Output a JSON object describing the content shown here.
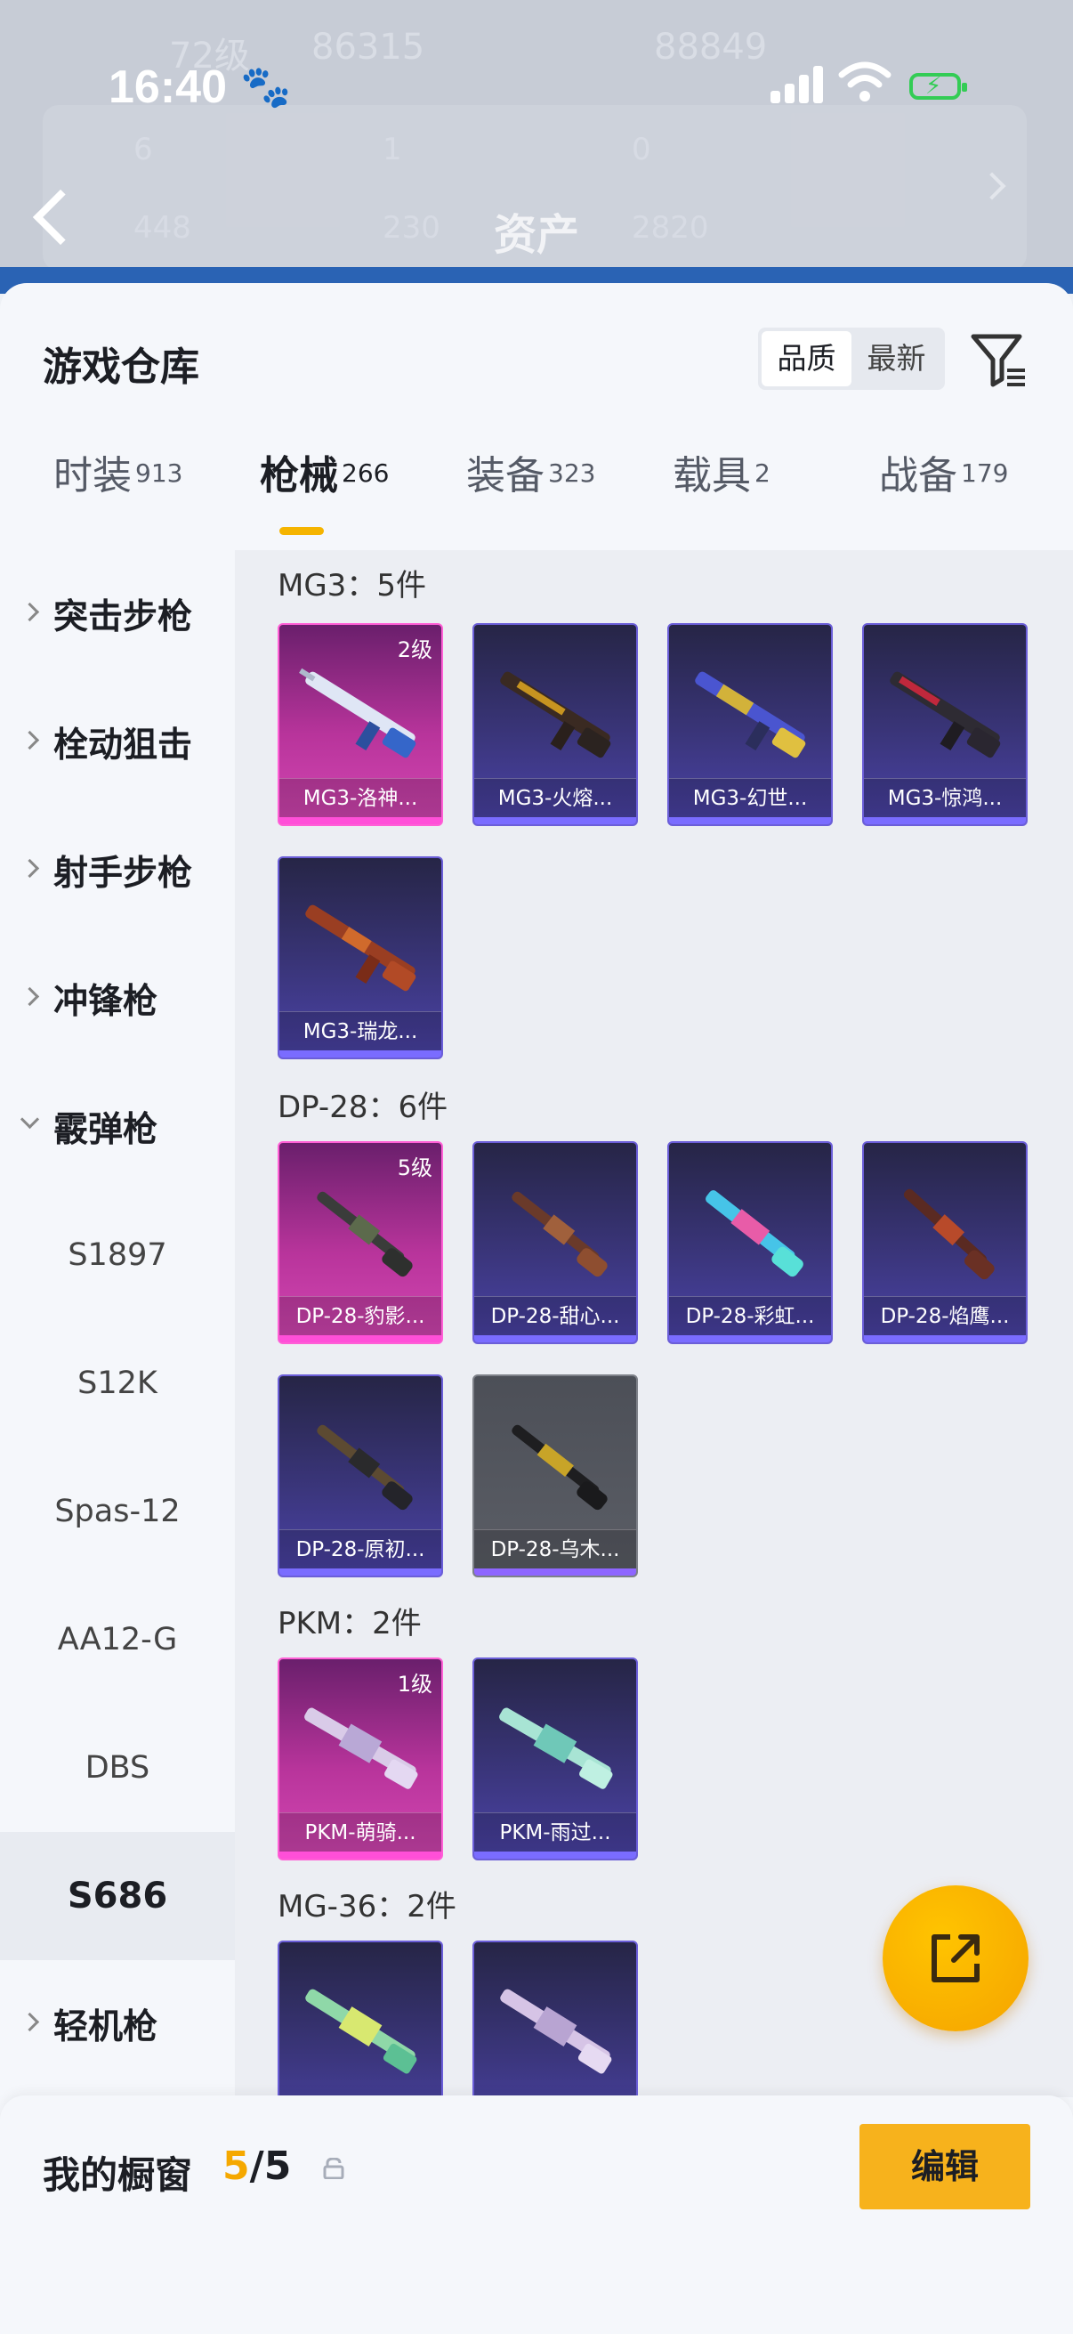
{
  "status_bar": {
    "time": "16:40"
  },
  "background": {
    "title": "资产",
    "ghost_texts": [
      "72级",
      "86315",
      "88849",
      "6",
      "1",
      "0",
      "448",
      "230",
      "2820"
    ]
  },
  "sheet": {
    "title": "游戏仓库",
    "sort_options": [
      "品质",
      "最新"
    ],
    "sort_selected": "品质"
  },
  "tabs": [
    {
      "label": "时装",
      "count": "913"
    },
    {
      "label": "枪械",
      "count": "266",
      "active": true
    },
    {
      "label": "装备",
      "count": "323"
    },
    {
      "label": "载具",
      "count": "2"
    },
    {
      "label": "战备",
      "count": "179"
    }
  ],
  "sidebar": {
    "categories": [
      "突击步枪",
      "栓动狙击",
      "射手步枪",
      "冲锋枪",
      "霰弹枪"
    ],
    "subitems": [
      "S1897",
      "S12K",
      "Spas-12",
      "AA12-G",
      "DBS",
      "S686"
    ],
    "selected_sub": "S686",
    "last_category": "轻机枪"
  },
  "groups": [
    {
      "title": "MG3：5件",
      "items": [
        {
          "name": "MG3-洛神...",
          "level": "2级",
          "rarity": "pink"
        },
        {
          "name": "MG3-火熔...",
          "rarity": "purple"
        },
        {
          "name": "MG3-幻世...",
          "rarity": "purple"
        },
        {
          "name": "MG3-惊鸿...",
          "rarity": "purple"
        },
        {
          "name": "MG3-瑞龙...",
          "rarity": "purple"
        }
      ]
    },
    {
      "title": "DP-28：6件",
      "items": [
        {
          "name": "DP-28-豹影...",
          "level": "5级",
          "rarity": "pink"
        },
        {
          "name": "DP-28-甜心...",
          "rarity": "purple"
        },
        {
          "name": "DP-28-彩虹...",
          "rarity": "purple"
        },
        {
          "name": "DP-28-焰鹰...",
          "rarity": "purple"
        },
        {
          "name": "DP-28-原初...",
          "rarity": "purple"
        },
        {
          "name": "DP-28-乌木...",
          "rarity": "gray"
        }
      ]
    },
    {
      "title": "PKM：2件",
      "items": [
        {
          "name": "PKM-萌骑...",
          "level": "1级",
          "rarity": "pink"
        },
        {
          "name": "PKM-雨过...",
          "rarity": "purple"
        }
      ]
    },
    {
      "title": "MG-36：2件",
      "items": [
        {
          "name": "",
          "rarity": "purple"
        },
        {
          "name": "",
          "rarity": "purple"
        }
      ]
    }
  ],
  "footer": {
    "label": "我的橱窗",
    "current": "5",
    "total": "/5",
    "edit_label": "编辑"
  },
  "colors": {
    "accent": "#f5b400",
    "pink_rarity": "#d447b3",
    "purple_rarity": "#4b43a8",
    "gray_rarity": "#5b5e66"
  }
}
